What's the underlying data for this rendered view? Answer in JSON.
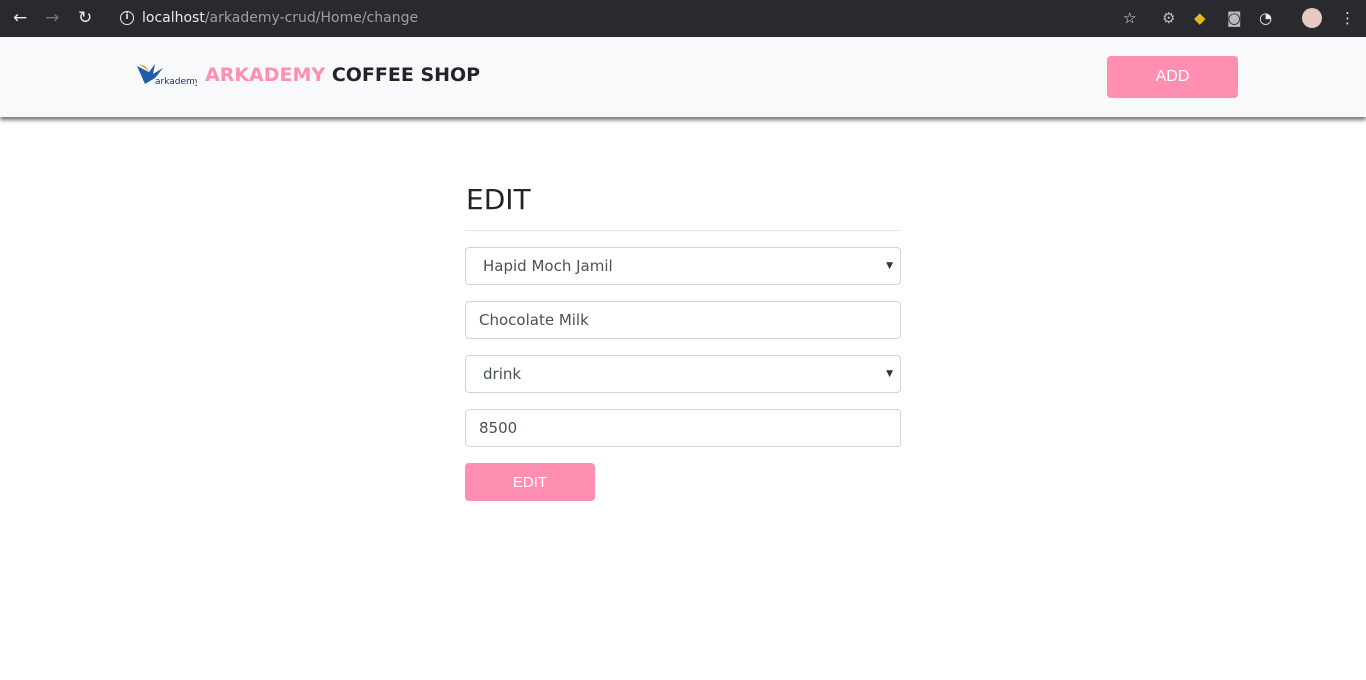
{
  "browser": {
    "url_host": "localhost",
    "url_path": "/arkademy-crud/Home/change"
  },
  "navbar": {
    "brand_pink": "ARKADEMY",
    "brand_rest": "COFFEE SHOP",
    "logo_text": "arkademy",
    "add_label": "ADD"
  },
  "form": {
    "title": "EDIT",
    "cashier": "Hapid Moch Jamil",
    "product": "Chocolate Milk",
    "category": "drink",
    "price": "8500",
    "submit_label": "EDIT"
  },
  "colors": {
    "accent": "#ff8fb1"
  }
}
